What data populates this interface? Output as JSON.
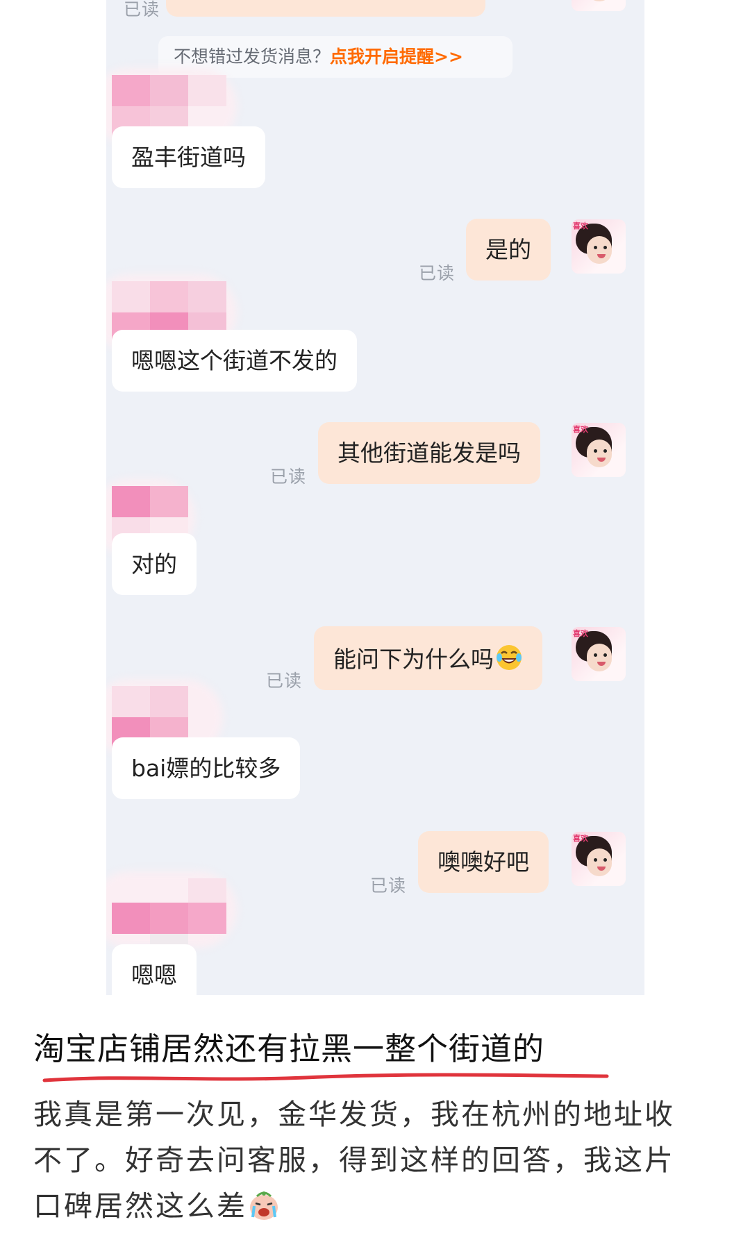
{
  "chat": {
    "top_read": "已读",
    "tip": {
      "text": "不想错过发货消息？",
      "link": "点我开启提醒>>"
    },
    "messages": [
      {
        "side": "in",
        "text": "盈丰街道吗"
      },
      {
        "side": "out",
        "text": "是的",
        "status": "已读"
      },
      {
        "side": "in",
        "text": "嗯嗯这个街道不发的"
      },
      {
        "side": "out",
        "text": "其他街道能发是吗",
        "status": "已读"
      },
      {
        "side": "in",
        "text": "对的"
      },
      {
        "side": "out",
        "text": "能问下为什么吗",
        "emoji": "laughing-tears-emoji",
        "status": "已读"
      },
      {
        "side": "in",
        "text": "bai嫖的比较多"
      },
      {
        "side": "out",
        "text": "噢噢好吧",
        "status": "已读"
      },
      {
        "side": "in",
        "text": "嗯嗯"
      }
    ],
    "avatar_tag": "喜欢"
  },
  "post": {
    "headline": "淘宝店铺居然还有拉黑一整个街道的",
    "body_lines": [
      "我真是第一次见，金华发货，我在杭州的地址收",
      "不了。好奇去问客服，得到这样的回答，我这片",
      "口碑居然这么差"
    ],
    "trailing_emoji": "crying-face-emoji"
  },
  "colors": {
    "chat_bg": "#eef1f7",
    "incoming_bubble": "#ffffff",
    "outgoing_bubble": "#fde6d7",
    "link": "#ff6a00",
    "read_status": "#9aa0aa",
    "underline": "#e0343c",
    "mosaic_pink": "#f28fbb"
  }
}
